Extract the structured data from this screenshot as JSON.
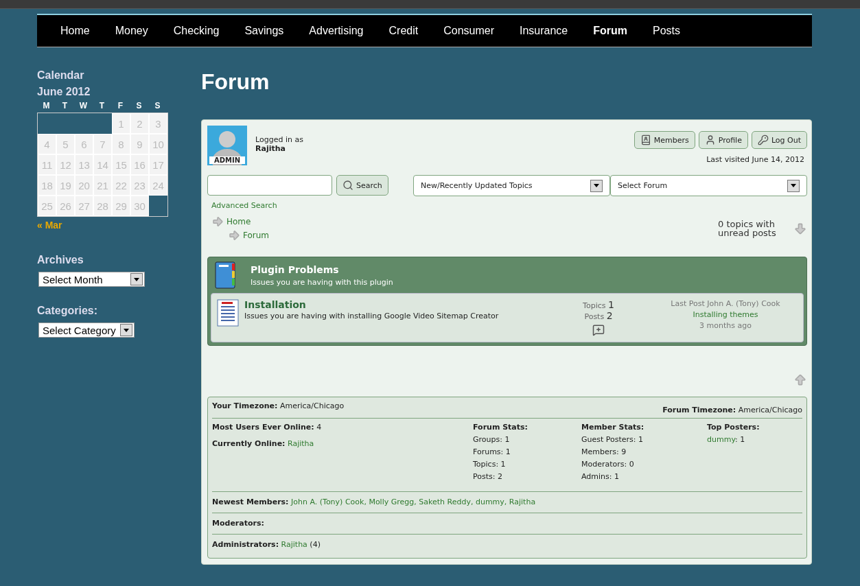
{
  "nav": [
    {
      "label": "Home",
      "selected": false
    },
    {
      "label": "Money",
      "selected": false
    },
    {
      "label": "Checking",
      "selected": false
    },
    {
      "label": "Savings",
      "selected": false
    },
    {
      "label": "Advertising",
      "selected": false
    },
    {
      "label": "Credit",
      "selected": false
    },
    {
      "label": "Consumer",
      "selected": false
    },
    {
      "label": "Insurance",
      "selected": false
    },
    {
      "label": "Forum",
      "selected": true
    },
    {
      "label": "Posts",
      "selected": false
    }
  ],
  "sidebar": {
    "calendar": {
      "title": "Calendar",
      "month": "June 2012",
      "weekdays": [
        "M",
        "T",
        "W",
        "T",
        "F",
        "S",
        "S"
      ],
      "weeks": [
        {
          "kind": "first",
          "days": [
            "1",
            "2",
            "3"
          ]
        },
        {
          "kind": "week",
          "days": [
            "4",
            "5",
            "6",
            "7",
            "8",
            "9",
            "10"
          ]
        },
        {
          "kind": "week",
          "days": [
            "11",
            "12",
            "13",
            "14",
            "15",
            "16",
            "17"
          ]
        },
        {
          "kind": "week",
          "days": [
            "18",
            "19",
            "20",
            "21",
            "22",
            "23",
            "24"
          ]
        },
        {
          "kind": "week",
          "days": [
            "25",
            "26",
            "27",
            "28",
            "29",
            "30"
          ]
        }
      ],
      "prev_link": "« Mar"
    },
    "archives": {
      "title": "Archives",
      "select": "Select Month"
    },
    "categories": {
      "title": "Categories:",
      "select": "Select Category"
    }
  },
  "page_title": "Forum",
  "user": {
    "avatar_badge": "ADMIN",
    "logged_in_label": "Logged in as",
    "name": "Rajitha",
    "buttons": [
      "Members",
      "Profile",
      "Log Out"
    ],
    "last_visited": "Last visited June 14, 2012"
  },
  "search": {
    "button": "Search",
    "advanced": "Advanced Search"
  },
  "selects": [
    "New/Recently Updated Topics",
    "Select Forum"
  ],
  "breadcrumbs": [
    "Home",
    "Forum"
  ],
  "unread": "0 topics with unread posts",
  "group": {
    "title": "Plugin Problems",
    "description": "Issues you are having with this plugin",
    "forums": [
      {
        "title": "Installation",
        "description": "Issues you are having with installing Google Video Sitemap Creator",
        "topics_label": "Topics",
        "topics": "1",
        "posts_label": "Posts",
        "posts": "2",
        "last_post": "Last Post John A. (Tony) Cook",
        "last_topic": "Installing themes",
        "last_time": "3 months ago"
      }
    ]
  },
  "stats": {
    "your_timezone": {
      "label": "Your Timezone:",
      "value": "America/Chicago"
    },
    "forum_timezone": {
      "label": "Forum Timezone:",
      "value": "America/Chicago"
    },
    "most_users": {
      "label": "Most Users Ever Online:",
      "value": "4"
    },
    "currently_online": {
      "label": "Currently Online:",
      "users": [
        "Rajitha"
      ]
    },
    "forum_stats": {
      "title": "Forum Stats:",
      "items": [
        "Groups: 1",
        "Forums: 1",
        "Topics: 1",
        "Posts: 2"
      ]
    },
    "member_stats": {
      "title": "Member Stats:",
      "items": [
        "Guest Posters: 1",
        "Members: 9",
        "Moderators: 0",
        "Admins: 1"
      ]
    },
    "top_posters": {
      "title": "Top Posters:",
      "items": [
        {
          "name": "dummy",
          "count": ": 1"
        }
      ]
    },
    "newest_members": {
      "label": "Newest Members:",
      "separator": ", ",
      "members": [
        "John A. (Tony) Cook",
        "Molly Gregg",
        "Saketh Reddy",
        "dummy",
        "Rajitha"
      ]
    },
    "moderators": {
      "label": "Moderators:"
    },
    "administrators": {
      "label": "Administrators:",
      "members": [
        {
          "name": "Rajitha",
          "count": " (4)"
        }
      ]
    }
  }
}
